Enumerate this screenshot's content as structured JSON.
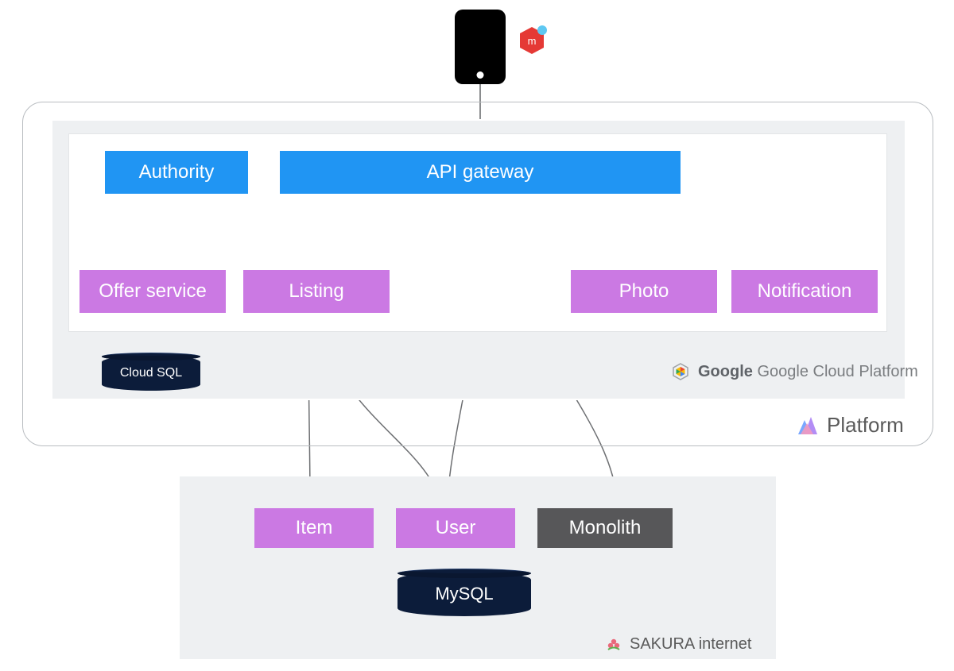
{
  "nodes": {
    "authority": "Authority",
    "api_gateway": "API gateway",
    "offer_service": "Offer service",
    "listing": "Listing",
    "photo": "Photo",
    "notification": "Notification",
    "item": "Item",
    "user": "User",
    "monolith": "Monolith"
  },
  "databases": {
    "cloud_sql": "Cloud SQL",
    "mysql": "MySQL"
  },
  "labels": {
    "gcp": "Google Cloud Platform",
    "platform": "Platform",
    "sakura": "SAKURA internet"
  },
  "colors": {
    "blue": "#2095f3",
    "purple": "#cb79e3",
    "dark": "#575759",
    "navy": "#0c1c3a"
  },
  "icons": {
    "app": "mercari-app-icon",
    "gcp": "gcp-hexagon-icon",
    "platform": "platform-triangles-icon",
    "sakura": "sakura-flower-icon"
  }
}
